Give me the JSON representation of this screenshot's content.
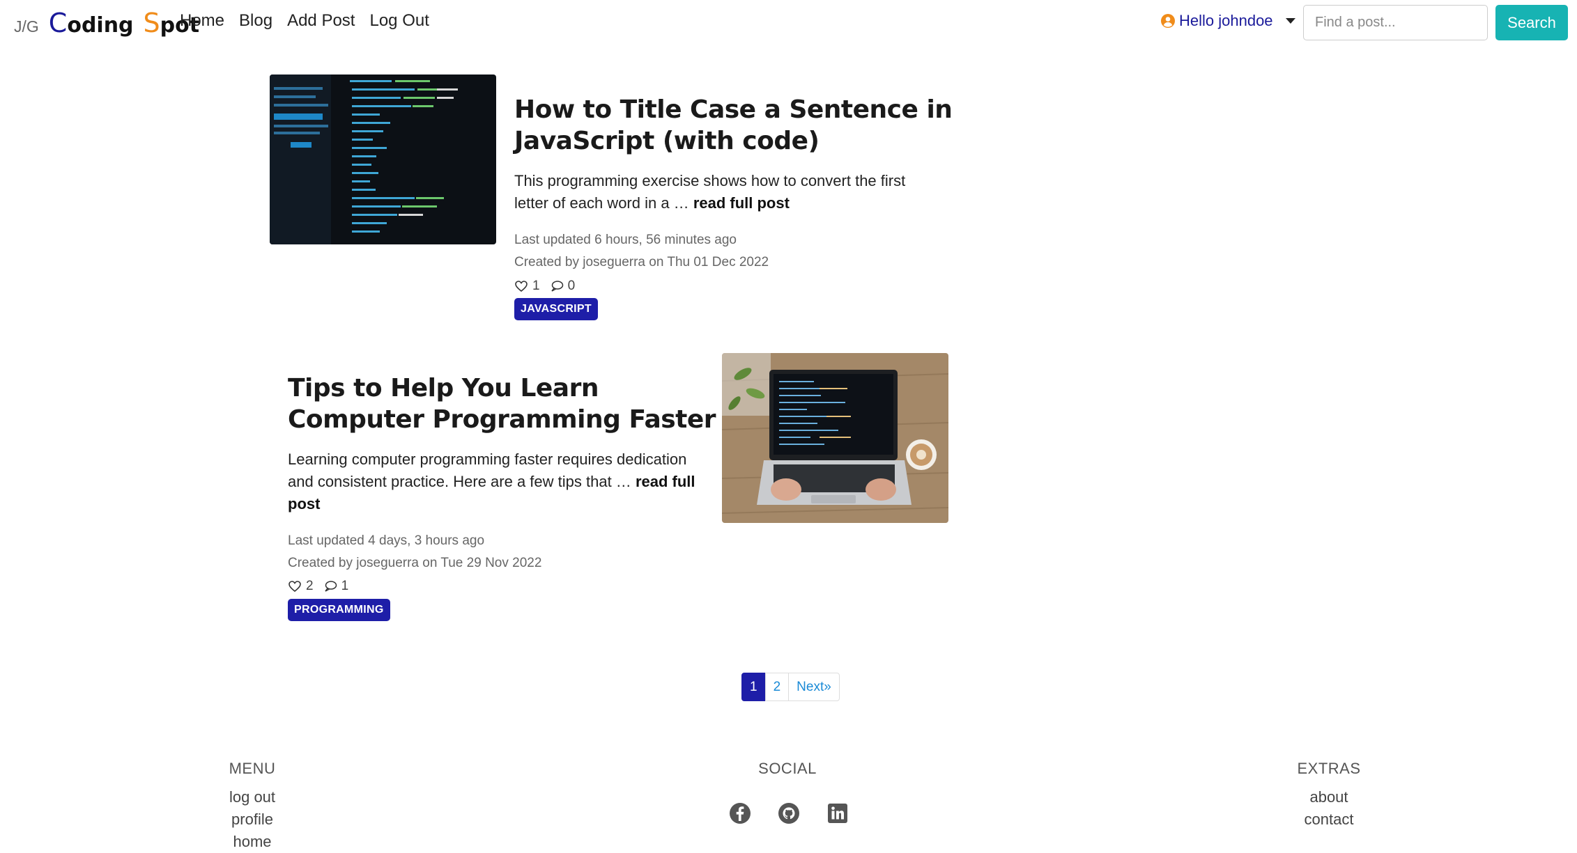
{
  "brand": {
    "prefix": "J/G",
    "c_letter": "C",
    "c_rest": "oding",
    "s_letter": "S",
    "s_rest": "pot"
  },
  "nav": {
    "home": "Home",
    "blog": "Blog",
    "add_post": "Add Post",
    "log_out": "Log Out"
  },
  "user_menu": {
    "label": "Hello johndoe"
  },
  "search": {
    "placeholder": "Find a post...",
    "button": "Search"
  },
  "posts": [
    {
      "title": "How to Title Case a Sentence in JavaScript (with code)",
      "excerpt": "This programming exercise shows how to convert the first letter of each word in a …",
      "read_more": "read full post",
      "updated": "Last updated 6 hours, 56 minutes ago",
      "created": "Created by joseguerra on Thu 01 Dec 2022",
      "likes": "1",
      "comments": "0",
      "tag": "JAVASCRIPT",
      "image_icon": "code-screen-image"
    },
    {
      "title": "Tips to Help You Learn Computer Programming Faster",
      "excerpt": "Learning computer programming faster requires dedication and consistent practice. Here are a few tips that …",
      "read_more": "read full post",
      "updated": "Last updated 4 days, 3 hours ago",
      "created": "Created by joseguerra on Tue 29 Nov 2022",
      "likes": "2",
      "comments": "1",
      "tag": "PROGRAMMING",
      "image_icon": "laptop-coffee-image"
    }
  ],
  "pagination": {
    "pages": [
      "1",
      "2"
    ],
    "next": "Next»",
    "current": "1"
  },
  "footer": {
    "menu": {
      "heading": "MENU",
      "links": [
        "log out",
        "profile",
        "home"
      ]
    },
    "social": {
      "heading": "SOCIAL",
      "icons": [
        "facebook-icon",
        "github-icon",
        "linkedin-icon"
      ]
    },
    "extras": {
      "heading": "EXTRAS",
      "links": [
        "about",
        "contact"
      ]
    }
  },
  "colors": {
    "brand_blue": "#1a1a9a",
    "brand_orange": "#f08c1a",
    "search_button": "#17b3b3",
    "tag_bg": "#1e1ea8",
    "link_blue": "#1a8ad6"
  }
}
